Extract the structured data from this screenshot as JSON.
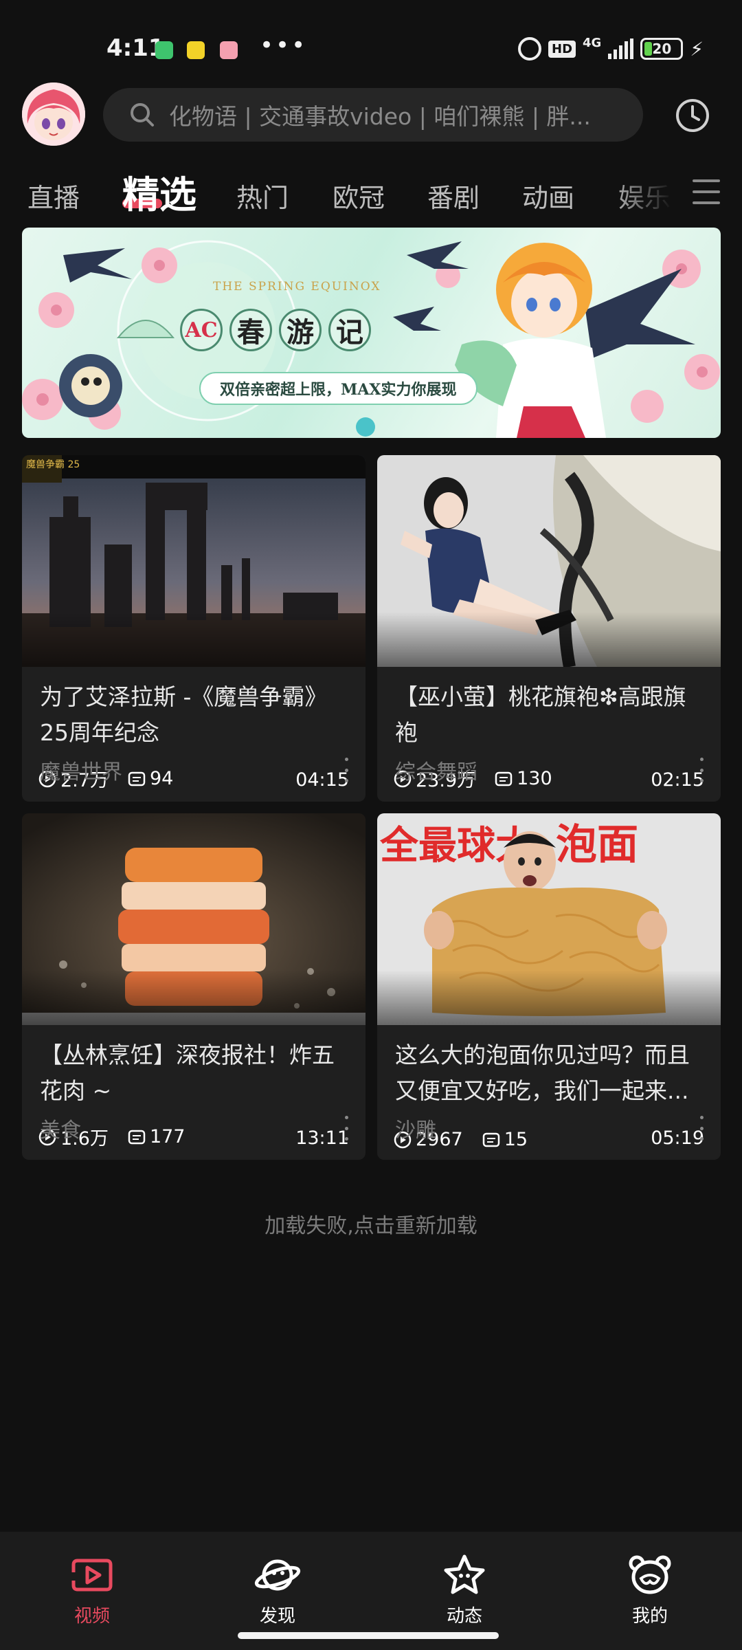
{
  "status_bar": {
    "time": "4:11",
    "network": "4G",
    "hd": "HD",
    "battery": "20",
    "battery_level": 0.2
  },
  "header": {
    "search_placeholder": "化物语 | 交通事故video | 咱们裸熊 | 胖..."
  },
  "tabs": [
    "直播",
    "精选",
    "热门",
    "欧冠",
    "番剧",
    "动画",
    "娱乐"
  ],
  "active_tab": "精选",
  "banner": {
    "equinox_text": "THE SPRING EQUINOX",
    "title_chars": [
      "AC",
      "春",
      "游",
      "记"
    ],
    "subtitle": "双倍亲密超上限，MAX实力你展现"
  },
  "videos": [
    {
      "plays": "2.7万",
      "comments": "94",
      "duration": "04:15",
      "title": "为了艾泽拉斯 -《魔兽争霸》25周年纪念",
      "category": "魔兽世界",
      "badge": "魔兽争霸 25"
    },
    {
      "plays": "23.9万",
      "comments": "130",
      "duration": "02:15",
      "title": "【巫小萤】桃花旗袍❇高跟旗袍",
      "category": "综合舞蹈"
    },
    {
      "plays": "1.6万",
      "comments": "177",
      "duration": "13:11",
      "title": "【丛林烹饪】深夜报社！炸五花肉 ~",
      "category": "美食"
    },
    {
      "plays": "2967",
      "comments": "15",
      "duration": "05:19",
      "title": "这么大的泡面你见过吗？而且又便宜又好吃，我们一起来...",
      "category": "沙雕",
      "overlay_left": "全最球大",
      "overlay_right": "泡面"
    }
  ],
  "load_fail_text": "加载失败,点击重新加载",
  "bottom_nav": [
    {
      "label": "视频",
      "icon": "video-icon"
    },
    {
      "label": "发现",
      "icon": "planet-icon"
    },
    {
      "label": "动态",
      "icon": "star-icon"
    },
    {
      "label": "我的",
      "icon": "bear-icon"
    }
  ],
  "colors": {
    "accent": "#e84a5f",
    "background": "#111111",
    "card": "#1f1f1f"
  }
}
